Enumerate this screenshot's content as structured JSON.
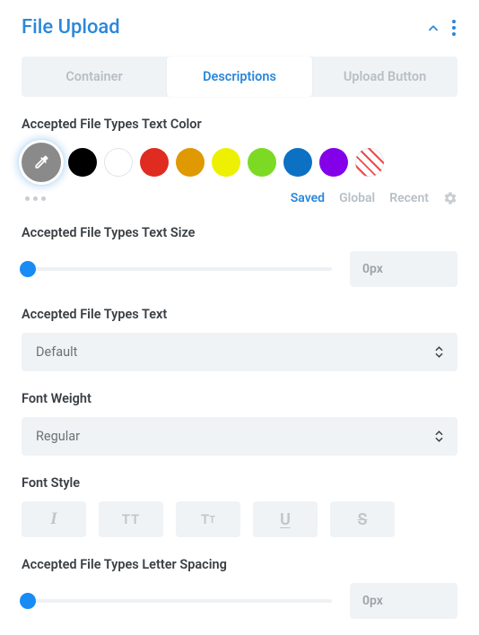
{
  "header": {
    "title": "File Upload"
  },
  "tabs": [
    {
      "label": "Container",
      "active": false
    },
    {
      "label": "Descriptions",
      "active": true
    },
    {
      "label": "Upload Button",
      "active": false
    }
  ],
  "textColor": {
    "label": "Accepted File Types Text Color",
    "swatches": [
      {
        "type": "eyedropper"
      },
      {
        "type": "color",
        "value": "#000000"
      },
      {
        "type": "color",
        "value": "#ffffff",
        "outlined": true
      },
      {
        "type": "color",
        "value": "#e02b20"
      },
      {
        "type": "color",
        "value": "#e09900"
      },
      {
        "type": "color",
        "value": "#edf000"
      },
      {
        "type": "color",
        "value": "#7cda24"
      },
      {
        "type": "color",
        "value": "#0c71c3"
      },
      {
        "type": "color",
        "value": "#8300e9"
      },
      {
        "type": "striped"
      }
    ],
    "source_tabs": {
      "saved": "Saved",
      "global": "Global",
      "recent": "Recent",
      "active": "saved"
    }
  },
  "textSize": {
    "label": "Accepted File Types Text Size",
    "value": "0px",
    "slider_position": 0
  },
  "font": {
    "label": "Accepted File Types Text",
    "value": "Default"
  },
  "fontWeight": {
    "label": "Font Weight",
    "value": "Regular"
  },
  "fontStyle": {
    "label": "Font Style",
    "buttons": {
      "italic": "I",
      "uppercase": "TT",
      "smallcaps_lg": "T",
      "smallcaps_sm": "T",
      "underline": "U",
      "strike": "S"
    }
  },
  "letterSpacing": {
    "label": "Accepted File Types Letter Spacing",
    "value": "0px",
    "slider_position": 0
  }
}
